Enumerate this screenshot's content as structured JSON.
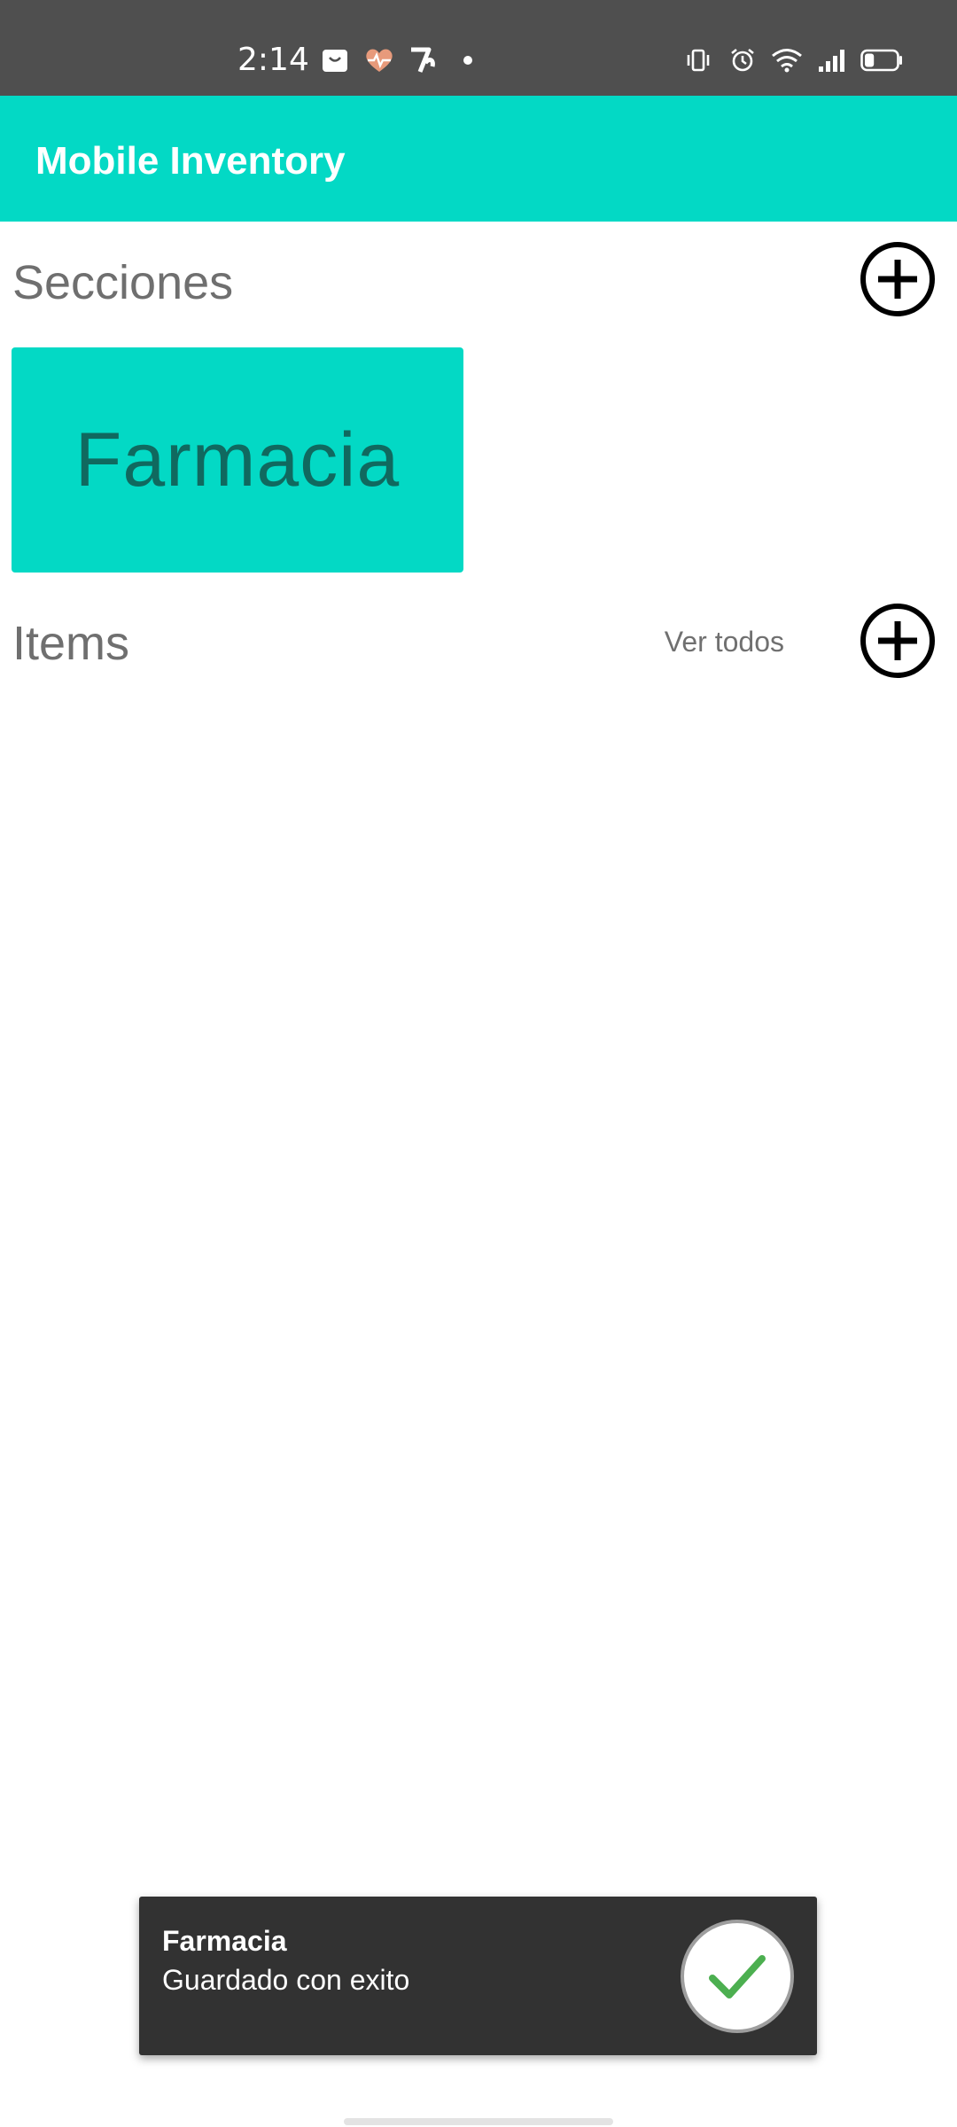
{
  "status_bar": {
    "time": "2:14",
    "notification_icons": [
      "bag-icon",
      "heart-rate-icon",
      "app-logo-icon",
      "dot-icon"
    ],
    "system_icons": [
      "vibrate-icon",
      "alarm-icon",
      "wifi-icon",
      "signal-icon",
      "battery-icon"
    ],
    "battery_level": 0.3
  },
  "app_bar": {
    "title": "Mobile Inventory",
    "color": "#03d9c5"
  },
  "sections": {
    "heading": "Secciones",
    "add_icon": "add-circle-icon",
    "cards": [
      {
        "label": "Farmacia"
      }
    ]
  },
  "items": {
    "heading": "Items",
    "see_all": "Ver todos",
    "add_icon": "add-circle-icon"
  },
  "toast": {
    "title": "Farmacia",
    "message": "Guardado con exito",
    "icon": "check-icon",
    "icon_color": "#4caf50"
  }
}
